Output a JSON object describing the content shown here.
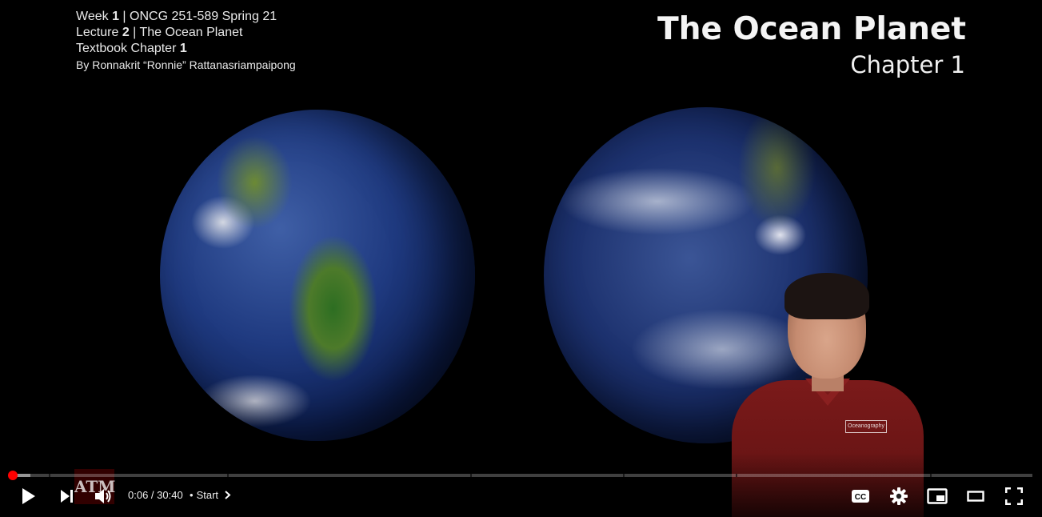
{
  "slide": {
    "week_label": "Week ",
    "week_num": "1",
    "course": " | ONCG 251-589 Spring 21",
    "lecture_label": "Lecture ",
    "lecture_num": "2",
    "lecture_title": " | The Ocean Planet",
    "textbook_label": "Textbook Chapter ",
    "textbook_num": "1",
    "author": "By Ronnakrit “Ronnie” Rattanasriampaipong",
    "title": "The Ocean Planet",
    "subtitle": "Chapter 1"
  },
  "presenter": {
    "shirt_logo": "Oceanography"
  },
  "watermark": {
    "text": "ATM"
  },
  "player": {
    "current_time": "0:06",
    "separator": " / ",
    "duration": "30:40",
    "chapter_bullet": "•",
    "chapter_label": "Start",
    "progress_played_fraction": 0.0033,
    "progress_buffered_fraction": 0.02,
    "chapter_marks_fraction": [
      0.038,
      0.213,
      0.45,
      0.6,
      0.71,
      0.9
    ],
    "accent_color": "#ff0000",
    "icons": [
      "play-icon",
      "next-icon",
      "volume-icon",
      "subtitles-icon",
      "settings-icon",
      "miniplayer-icon",
      "theater-icon",
      "fullscreen-icon"
    ]
  }
}
